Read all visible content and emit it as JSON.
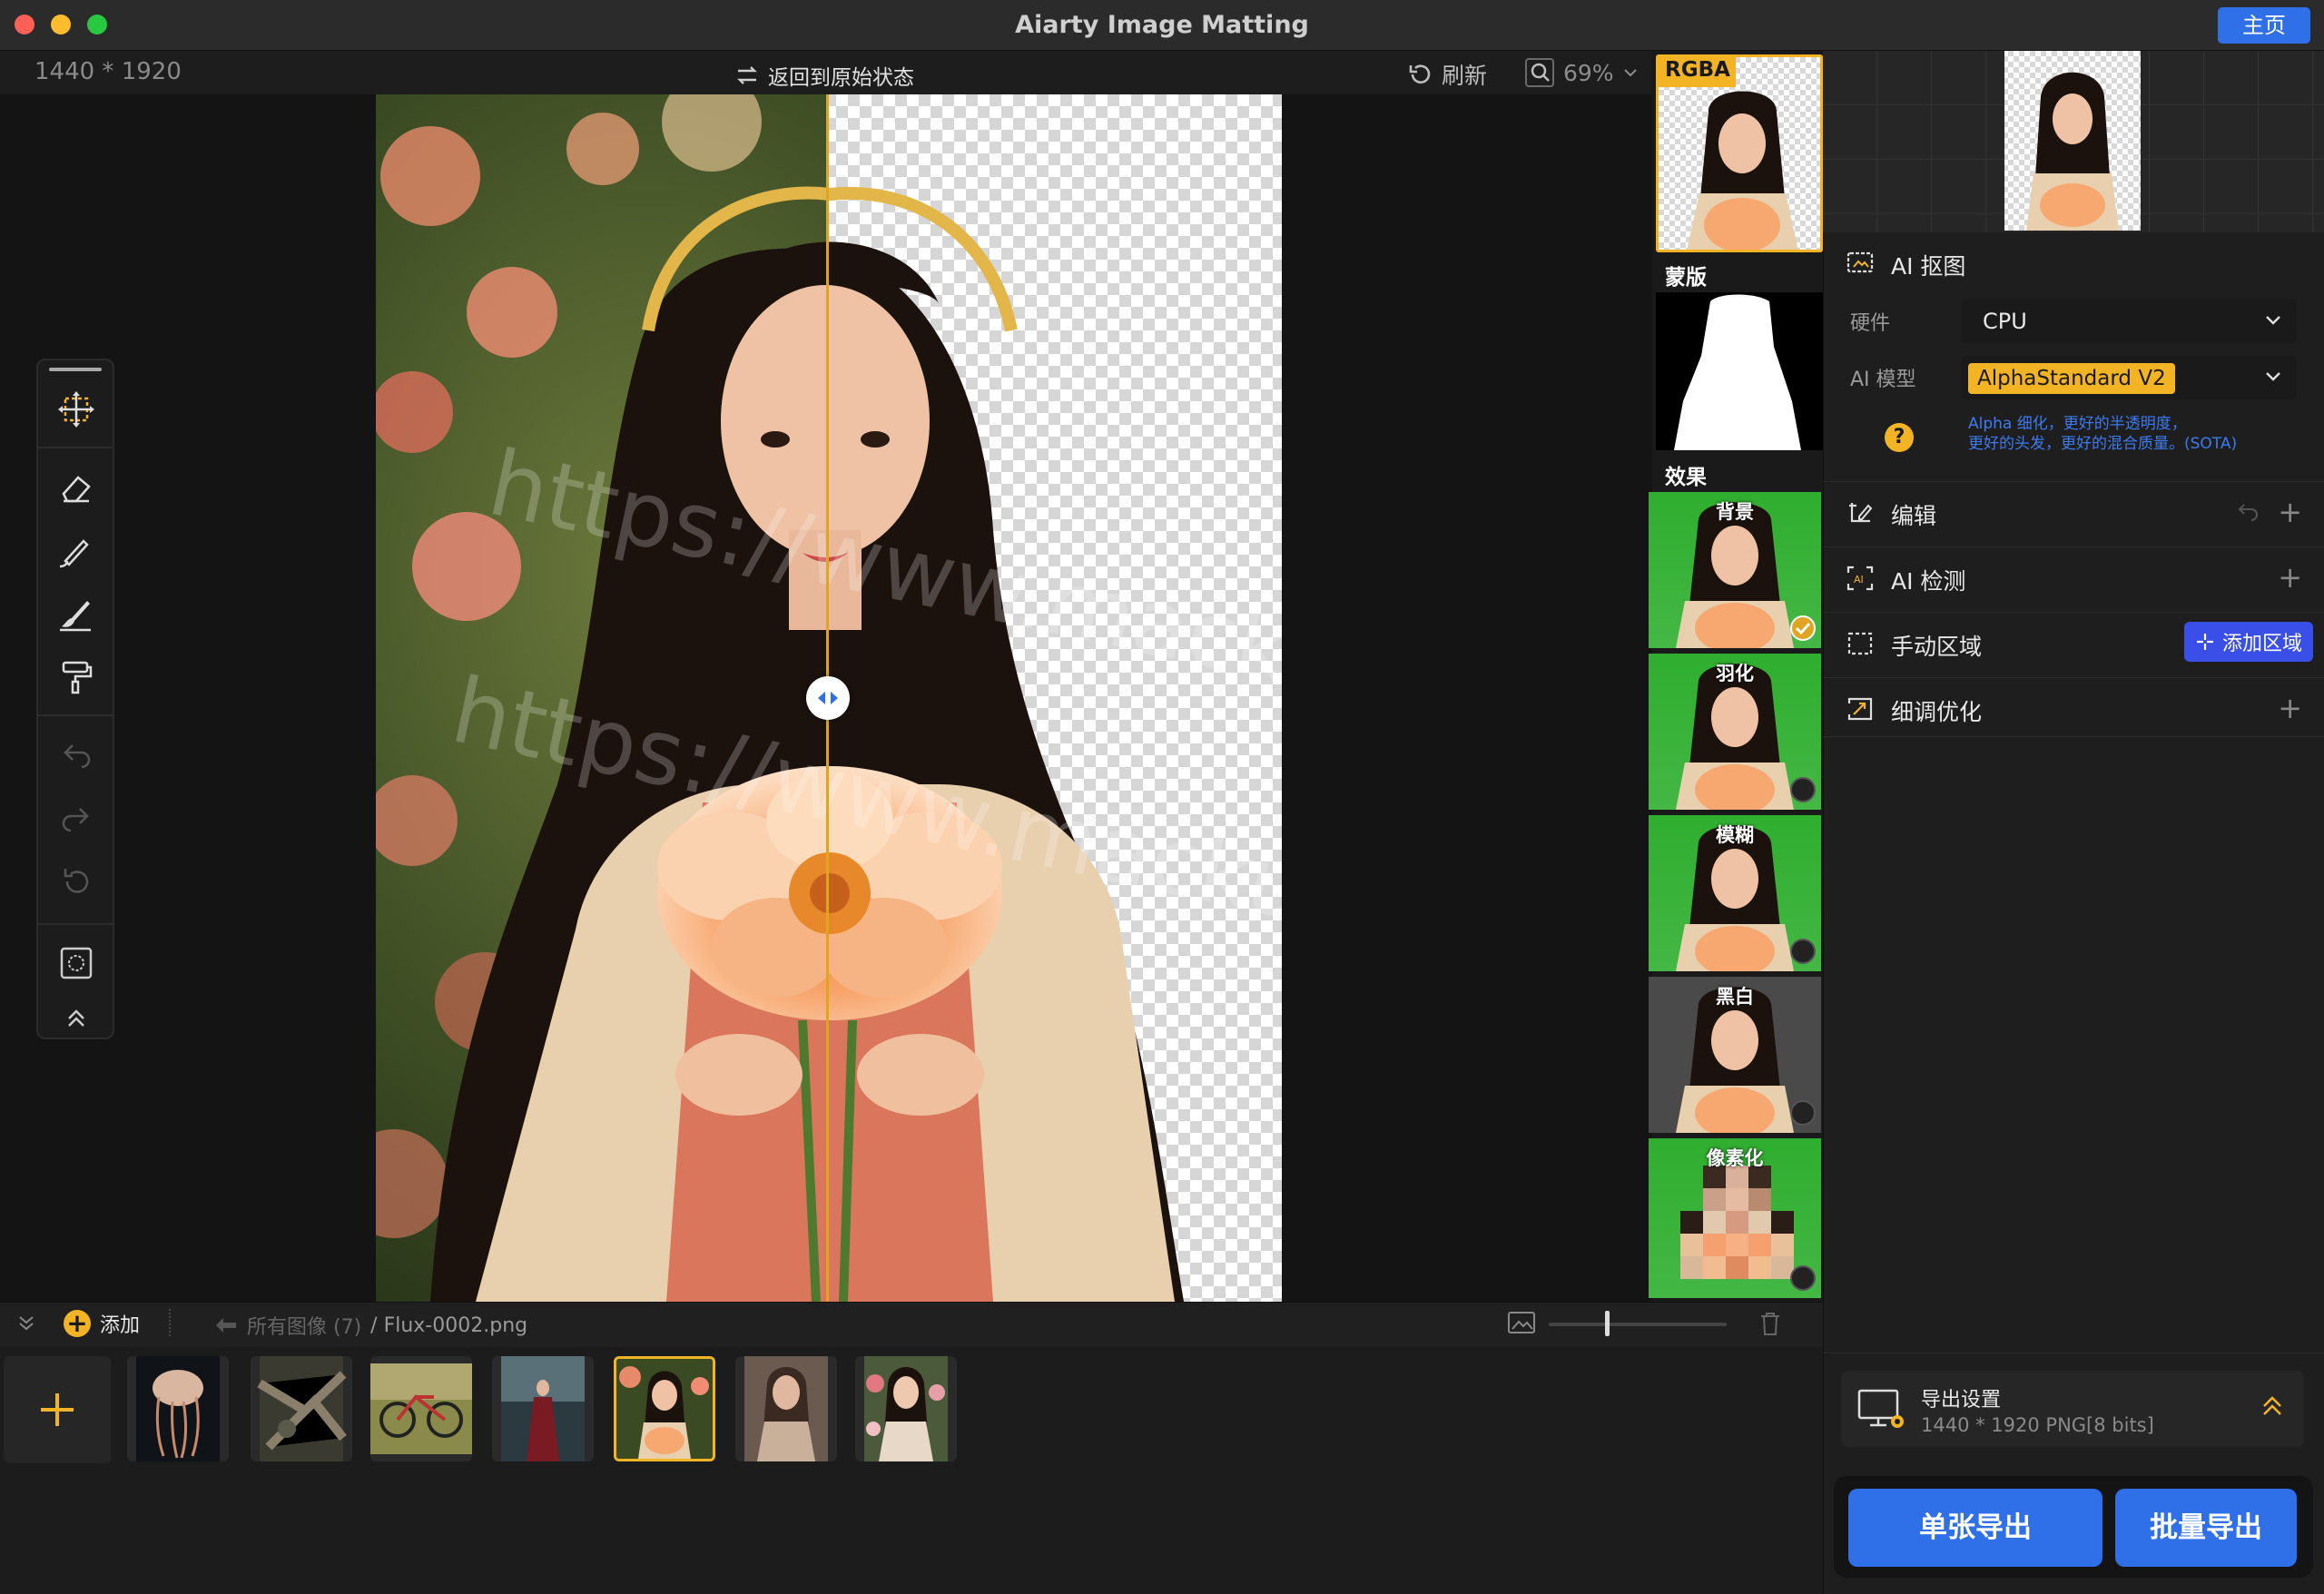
{
  "window": {
    "title": "Aiarty Image Matting",
    "home_label": "主页"
  },
  "canvas": {
    "image_size": "1440 * 1920",
    "revert_label": "返回到原始状态",
    "refresh_label": "刷新",
    "zoom": "69%",
    "watermark_1": "https://www.macku.pro/",
    "watermark_2": "https://www.macku.pro/"
  },
  "previews": {
    "rgba_label": "RGBA",
    "mask_label": "蒙版",
    "effects_label": "效果",
    "effects": [
      {
        "label": "背景",
        "selected": true
      },
      {
        "label": "羽化",
        "selected": false
      },
      {
        "label": "模糊",
        "selected": false
      },
      {
        "label": "黑白",
        "selected": false
      },
      {
        "label": "像素化",
        "selected": false
      }
    ]
  },
  "right_panel": {
    "ai_matting_label": "AI 抠图",
    "hardware_label": "硬件",
    "hardware_value": "CPU",
    "model_label": "AI 模型",
    "model_value": "AlphaStandard  V2",
    "model_desc_line1": "Alpha 细化，更好的半透明度，",
    "model_desc_line2": "更好的头发，更好的混合质量。(SOTA)",
    "edit_label": "编辑",
    "ai_detect_label": "AI 检测",
    "manual_region_label": "手动区域",
    "add_region_label": "添加区域",
    "refine_label": "细调优化",
    "export_settings_label": "导出设置",
    "export_settings_value": "1440 * 1920 PNG[8 bits]",
    "single_export_label": "单张导出",
    "batch_export_label": "批量导出"
  },
  "bottom_bar": {
    "add_label": "添加",
    "all_images_label": "所有图像 (7)",
    "current_file": "/ Flux-0002.png"
  },
  "thumbnails": [
    {
      "name": "jellyfish",
      "selected": false
    },
    {
      "name": "forest-debris",
      "selected": false
    },
    {
      "name": "bicycle",
      "selected": false
    },
    {
      "name": "woman-red-dress",
      "selected": false
    },
    {
      "name": "girl-flower",
      "selected": true
    },
    {
      "name": "woman-portrait",
      "selected": false
    },
    {
      "name": "woman-roses",
      "selected": false
    }
  ],
  "colors": {
    "accent_blue": "#2f6fe8",
    "accent_yellow": "#f2b324",
    "effect_green": "#3db33d"
  }
}
